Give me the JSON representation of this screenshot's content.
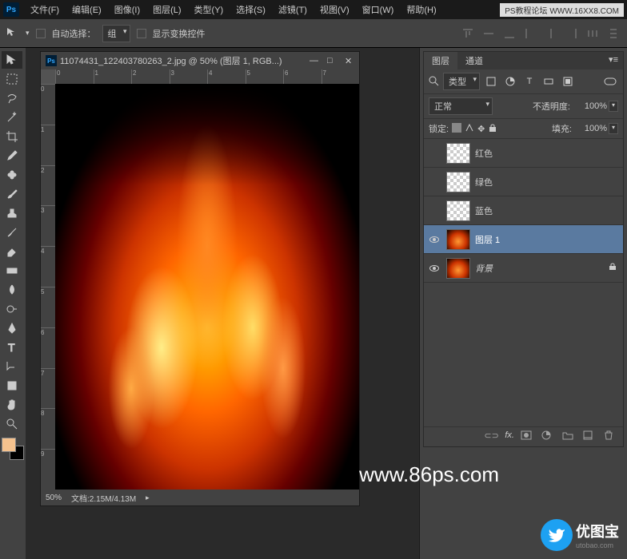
{
  "menu": [
    "文件(F)",
    "编辑(E)",
    "图像(I)",
    "图层(L)",
    "类型(Y)",
    "选择(S)",
    "滤镜(T)",
    "视图(V)",
    "窗口(W)",
    "帮助(H)"
  ],
  "top_right": "PS教程论坛 WWW.16XX8.COM",
  "options": {
    "auto_select": "自动选择：",
    "group": "组",
    "show_transform": "显示变换控件"
  },
  "document": {
    "title": "11074431_122403780263_2.jpg @ 50% (图层 1, RGB...)",
    "zoom": "50%",
    "size": "文档:2.15M/4.13M",
    "ruler_h": [
      "0",
      "1",
      "2",
      "3",
      "4",
      "5",
      "6",
      "7"
    ],
    "ruler_v": [
      "0",
      "1",
      "2",
      "3",
      "4",
      "5",
      "6",
      "7",
      "8",
      "9"
    ],
    "watermark": "www.86ps.com"
  },
  "layers_panel": {
    "tab_layers": "图层",
    "tab_channels": "通道",
    "kind": "类型",
    "blend_mode": "正常",
    "opacity_label": "不透明度:",
    "opacity": "100%",
    "lock_label": "锁定:",
    "fill_label": "填充:",
    "fill": "100%",
    "layers": [
      {
        "name": "红色",
        "thumb": "checker",
        "visible": false
      },
      {
        "name": "绿色",
        "thumb": "checker",
        "visible": false
      },
      {
        "name": "蓝色",
        "thumb": "checker",
        "visible": false
      },
      {
        "name": "图层 1",
        "thumb": "fire",
        "visible": true,
        "selected": true
      },
      {
        "name": "背景",
        "thumb": "fire",
        "visible": true,
        "locked": true,
        "italic": true
      }
    ]
  },
  "logo": {
    "text": "优图宝",
    "sub": "utobao.com"
  }
}
